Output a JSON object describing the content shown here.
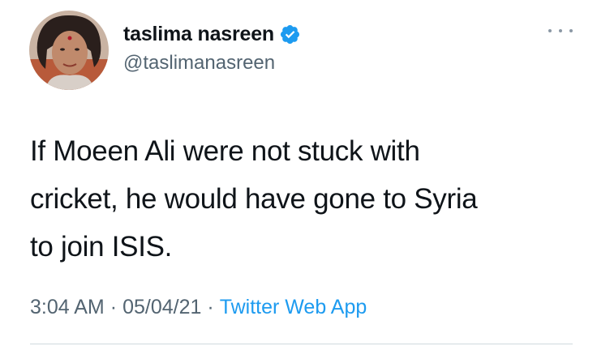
{
  "tweet": {
    "display_name": "taslima nasreen",
    "handle": "@taslimanasreen",
    "verified": true,
    "text": "If Moeen Ali were not stuck with\ncricket,  he would have gone to Syria\nto join ISIS.",
    "time": "3:04 AM",
    "separator": "·",
    "date": "05/04/21",
    "source": "Twitter Web App"
  },
  "icons": {
    "verified": "verified-badge-icon",
    "more": "more-options-icon"
  },
  "colors": {
    "verified_badge": "#1d9bf0",
    "link": "#1d9bf0",
    "secondary_text": "#536471"
  }
}
